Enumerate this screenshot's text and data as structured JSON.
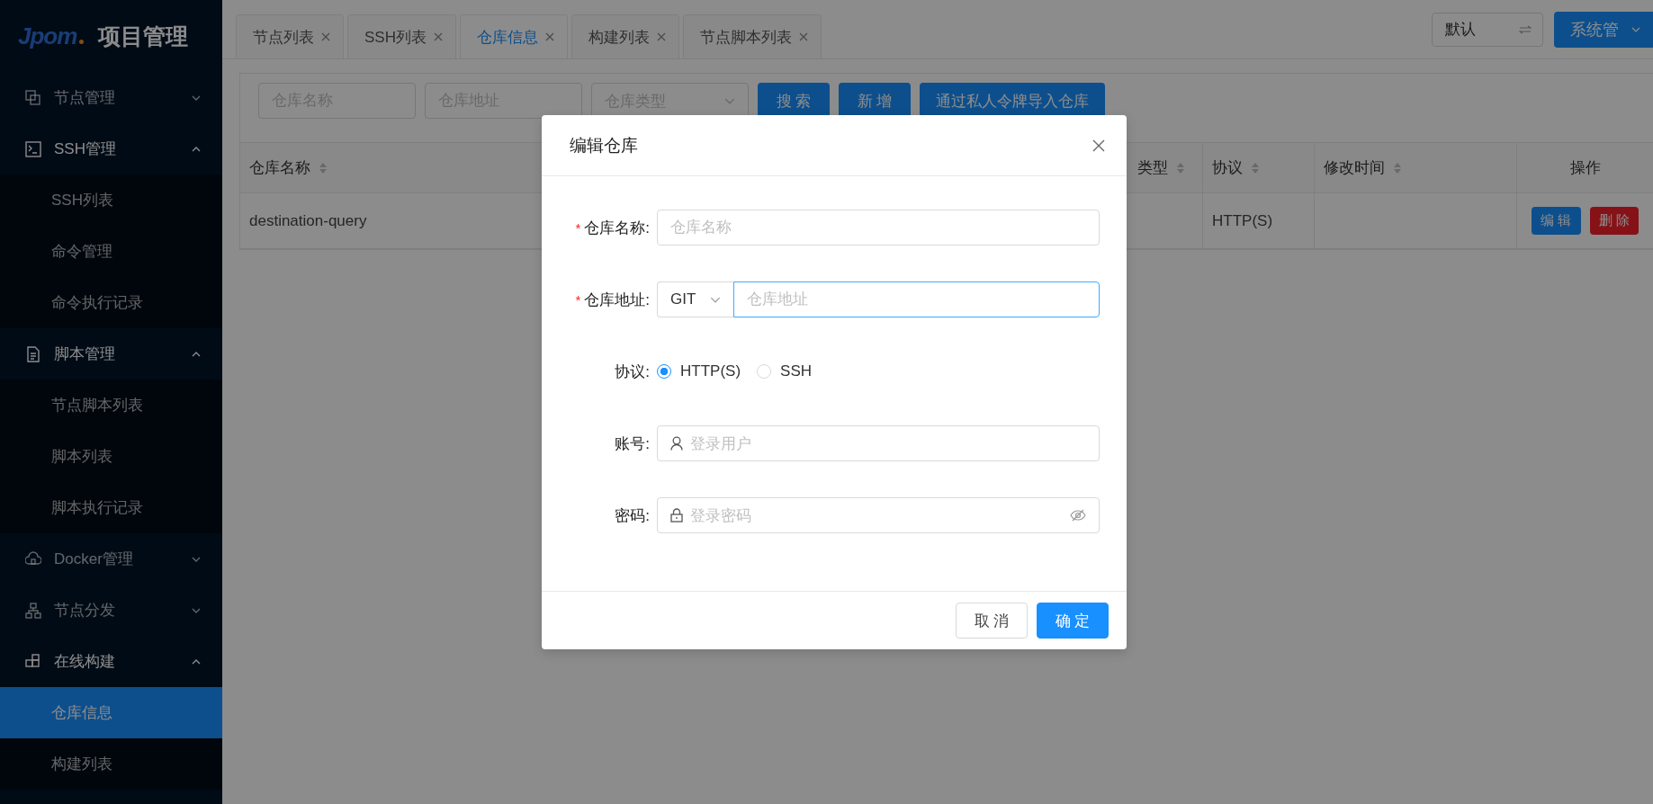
{
  "sidebar": {
    "logo": "Jpom",
    "title": "项目管理",
    "menu": [
      {
        "label": "节点管理",
        "expanded": false
      },
      {
        "label": "SSH管理",
        "expanded": true,
        "children": [
          {
            "label": "SSH列表",
            "selected": false
          },
          {
            "label": "命令管理",
            "selected": false
          },
          {
            "label": "命令执行记录",
            "selected": false
          }
        ]
      },
      {
        "label": "脚本管理",
        "expanded": true,
        "children": [
          {
            "label": "节点脚本列表",
            "selected": false
          },
          {
            "label": "脚本列表",
            "selected": false
          },
          {
            "label": "脚本执行记录",
            "selected": false
          }
        ]
      },
      {
        "label": "Docker管理",
        "expanded": false
      },
      {
        "label": "节点分发",
        "expanded": false
      },
      {
        "label": "在线构建",
        "expanded": true,
        "children": [
          {
            "label": "仓库信息",
            "selected": true
          },
          {
            "label": "构建列表",
            "selected": false
          }
        ]
      }
    ]
  },
  "tabs": [
    {
      "label": "节点列表",
      "selected": false
    },
    {
      "label": "SSH列表",
      "selected": false
    },
    {
      "label": "仓库信息",
      "selected": true
    },
    {
      "label": "构建列表",
      "selected": false
    },
    {
      "label": "节点脚本列表",
      "selected": false
    }
  ],
  "workspace_select": {
    "value": "默认"
  },
  "user_menu": {
    "label": "系统管"
  },
  "search": {
    "fields": [
      {
        "kind": "input",
        "placeholder": "仓库名称"
      },
      {
        "kind": "input",
        "placeholder": "仓库地址"
      },
      {
        "kind": "select",
        "placeholder": "仓库类型"
      }
    ],
    "buttons": [
      "搜 索",
      "新 增",
      "通过私人令牌导入仓库"
    ]
  },
  "table": {
    "columns": [
      {
        "label": "仓库名称",
        "sortable": true
      },
      {
        "label": "类型",
        "sortable": true
      },
      {
        "label": "协议",
        "sortable": true
      },
      {
        "label": "修改时间",
        "sortable": true
      },
      {
        "label": "操作",
        "sortable": false
      }
    ],
    "rows": [
      {
        "name": "destination-query",
        "protocol": "HTTP(S)",
        "actions": [
          {
            "label": "编 辑",
            "kind": "edit"
          },
          {
            "label": "删 除",
            "kind": "delete"
          }
        ]
      }
    ]
  },
  "modal": {
    "title": "编辑仓库",
    "fields": [
      {
        "kind": "input",
        "required_mark": "*",
        "label": "仓库名称:",
        "placeholder": "仓库名称"
      },
      {
        "kind": "addon",
        "required_mark": "*",
        "label": "仓库地址:",
        "addon": "GIT",
        "placeholder": "仓库地址",
        "focused": true
      },
      {
        "kind": "radio",
        "label": "协议:",
        "options": [
          {
            "label": "HTTP(S)",
            "selected": true
          },
          {
            "label": "SSH",
            "selected": false
          }
        ]
      },
      {
        "kind": "user",
        "label": "账号:",
        "placeholder": "登录用户"
      },
      {
        "kind": "password",
        "label": "密码:",
        "placeholder": "登录密码"
      }
    ],
    "buttons": [
      {
        "label": "取 消",
        "kind": "default"
      },
      {
        "label": "确 定",
        "kind": "primary"
      }
    ]
  }
}
